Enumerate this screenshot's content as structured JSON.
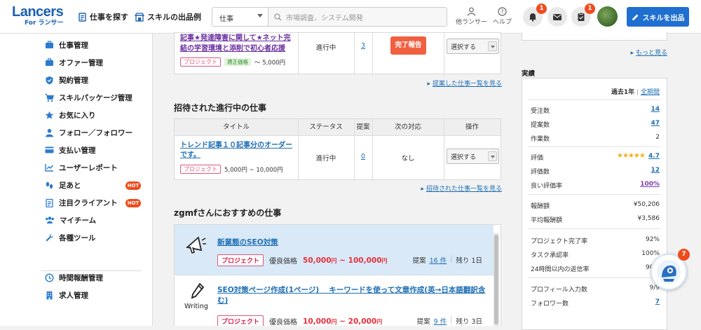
{
  "header": {
    "logo": "Lancers",
    "logo_sub": "For ランサー",
    "nav_find_work": "仕事を探す",
    "nav_skill_examples": "スキルの出品例",
    "search_category": "仕事",
    "search_placeholder": "市場調査、システム開発",
    "other_lancers": "他ランサー",
    "help": "ヘルプ",
    "notifications_count": "1",
    "tasks_count": "1",
    "sell_skill_button": "スキルを出品"
  },
  "sidebar": {
    "items": [
      {
        "label": "仕事管理",
        "icon": "briefcase-icon"
      },
      {
        "label": "オファー管理",
        "icon": "briefcase-icon"
      },
      {
        "label": "契約管理",
        "icon": "shield-icon"
      },
      {
        "label": "スキルパッケージ管理",
        "icon": "cart-icon"
      },
      {
        "label": "お気に入り",
        "icon": "star-icon"
      },
      {
        "label": "フォロー／フォロワー",
        "icon": "person-icon"
      },
      {
        "label": "支払い管理",
        "icon": "card-icon"
      },
      {
        "label": "ユーザーレポート",
        "icon": "chart-icon"
      },
      {
        "label": "足あと",
        "icon": "footprint-icon",
        "hot": "HOT"
      },
      {
        "label": "注目クライアント",
        "icon": "clipboard-icon",
        "hot": "HOT"
      },
      {
        "label": "マイチーム",
        "icon": "team-icon"
      },
      {
        "label": "各種ツール",
        "icon": "wrench-icon"
      },
      {
        "label": "時間報酬管理",
        "icon": "clock-icon"
      },
      {
        "label": "求人管理",
        "icon": "building-icon"
      }
    ]
  },
  "proposed_job": {
    "title": "記事★発達障害に関して★ネット完結の学習環境と添削で初心者応援",
    "tag": "プロジェクト",
    "price_tag": "適正価格",
    "price": "～ 5,000円",
    "status": "進行中",
    "proposals": "3",
    "action_button": "完了報告",
    "select_label": "選択する",
    "more_link": "提案した仕事一覧を見る"
  },
  "invited": {
    "section_title": "招待された進行中の仕事",
    "columns": [
      "タイトル",
      "ステータス",
      "提案",
      "次の対応",
      "操作"
    ],
    "rows": [
      {
        "title": "トレンド記事１０記事分のオーダーです。",
        "tag": "プロジェクト",
        "price": "5,000円 ~ 10,000円",
        "status": "進行中",
        "proposals": "0",
        "next": "なし",
        "select_label": "選択する"
      }
    ],
    "more_link": "招待された仕事一覧を見る"
  },
  "recommended": {
    "section_title": "zgmfさんにおすすめの仕事",
    "items": [
      {
        "title": "新業態のSEO対策",
        "tag": "プロジェクト",
        "price_label": "優良価格",
        "price_min": "50,000",
        "price_max": "100,000",
        "yen": "円",
        "tilde": "~",
        "proposals_label": "提案",
        "proposals": "16 件",
        "remaining": "残り 1日",
        "icon": "megaphone-icon"
      },
      {
        "title": "SEO対策ページ作成(1ページ)　 キーワードを使って文章作成(英→日本語翻訳含む)",
        "tag": "プロジェクト",
        "price_label": "優良価格",
        "price_min": "10,000",
        "price_max": "20,000",
        "yen": "円",
        "tilde": "~",
        "proposals_label": "提案",
        "proposals": "9 件",
        "remaining": "残り 3日",
        "icon": "pencil-icon",
        "icon_label": "Writing"
      }
    ]
  },
  "right": {
    "more_link": "もっと見る",
    "stats_title": "実績",
    "period_current": "過去1年",
    "period_separator": "|",
    "period_all": "全期間",
    "rows": [
      {
        "label": "受注数",
        "value": "14",
        "style": "link"
      },
      {
        "label": "提案数",
        "value": "47",
        "style": "link"
      },
      {
        "label": "作業数",
        "value": "2",
        "style": "plain"
      },
      {
        "label": "評価",
        "value": "4.7",
        "style": "link",
        "stars": 4.7
      },
      {
        "label": "評価数",
        "value": "12",
        "style": "link"
      },
      {
        "label": "良い評価率",
        "value": "100%",
        "style": "plink"
      },
      {
        "label": "報酬額",
        "value": "¥50,206",
        "style": "plain"
      },
      {
        "label": "平均報酬額",
        "value": "¥3,586",
        "style": "plain"
      },
      {
        "label": "プロジェクト完了率",
        "value": "92%",
        "style": "plain"
      },
      {
        "label": "タスク承認率",
        "value": "100%",
        "style": "plain"
      },
      {
        "label": "24時間以内の返信率",
        "value": "90%",
        "style": "plain"
      },
      {
        "label": "プロフィール入力数",
        "value": "9/9",
        "style": "plain"
      },
      {
        "label": "フォロワー数",
        "value": "7",
        "style": "link"
      }
    ]
  },
  "chat": {
    "badge": "7"
  },
  "colors": {
    "brand": "#1a5fb4",
    "accent": "#f04b1d",
    "price": "#e6303b"
  }
}
